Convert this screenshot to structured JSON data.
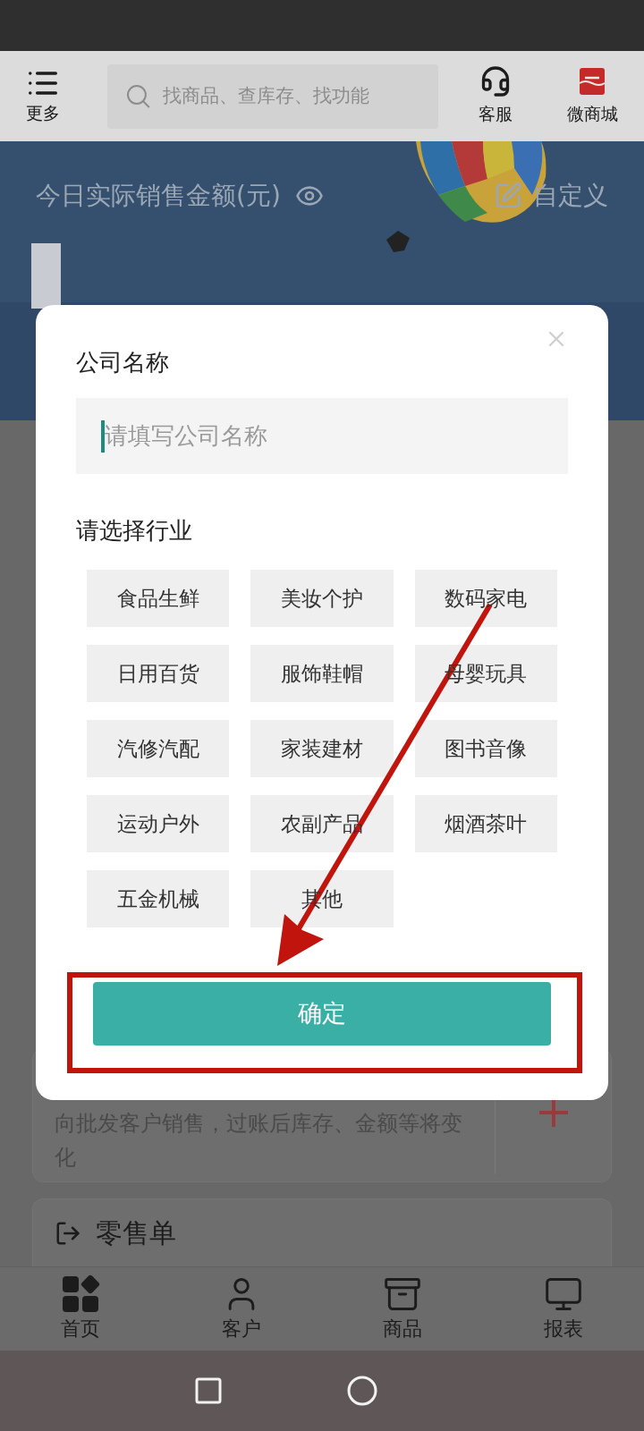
{
  "header": {
    "menu_label": "更多",
    "search_placeholder": "找商品、查库存、找功能",
    "actions": [
      {
        "label": "客服",
        "kind": "headset"
      },
      {
        "label": "微商城",
        "kind": "shop"
      }
    ]
  },
  "banner": {
    "title": "今日实际销售金额(元)",
    "customize_label": "自定义"
  },
  "cards": [
    {
      "kind": "description",
      "text": "向批发客户销售，过账后库存、金额等将变化"
    },
    {
      "kind": "title",
      "text": "零售单"
    }
  ],
  "bottom_nav": [
    {
      "label": "首页",
      "kind": "home"
    },
    {
      "label": "客户",
      "kind": "customer"
    },
    {
      "label": "商品",
      "kind": "goods"
    },
    {
      "label": "报表",
      "kind": "report"
    }
  ],
  "dialog": {
    "company_label": "公司名称",
    "company_placeholder": "请填写公司名称",
    "industry_label": "请选择行业",
    "industries": [
      {
        "label": "食品生鲜",
        "selected": false
      },
      {
        "label": "美妆个护",
        "selected": false
      },
      {
        "label": "数码家电",
        "selected": false
      },
      {
        "label": "日用百货",
        "selected": false
      },
      {
        "label": "服饰鞋帽",
        "selected": false
      },
      {
        "label": "母婴玩具",
        "selected": false
      },
      {
        "label": "汽修汽配",
        "selected": false
      },
      {
        "label": "家装建材",
        "selected": false
      },
      {
        "label": "图书音像",
        "selected": false
      },
      {
        "label": "运动户外",
        "selected": false
      },
      {
        "label": "农副产品",
        "selected": false
      },
      {
        "label": "烟酒茶叶",
        "selected": false
      },
      {
        "label": "五金机械",
        "selected": false
      },
      {
        "label": "其他",
        "selected": false
      }
    ],
    "confirm": "确定"
  }
}
